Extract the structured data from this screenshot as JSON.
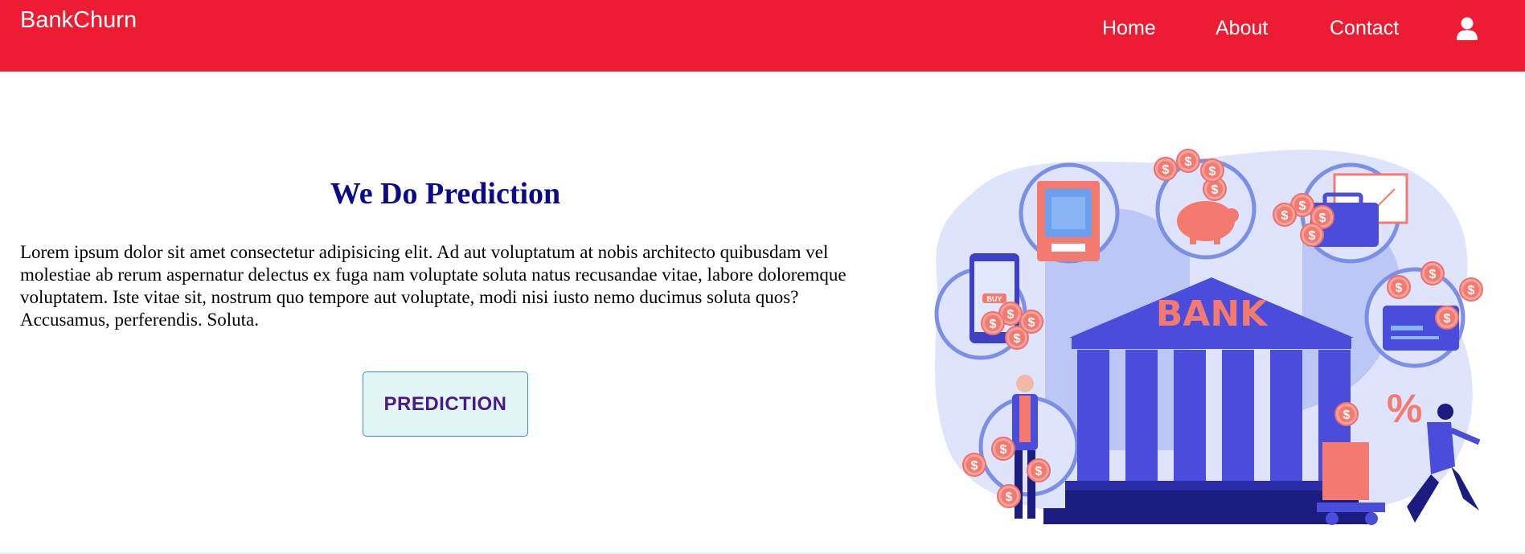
{
  "navbar": {
    "brand": "BankChurn",
    "links": [
      {
        "label": "Home"
      },
      {
        "label": "About"
      },
      {
        "label": "Contact"
      }
    ],
    "bg_color": "#ed1c33",
    "user_icon": "user-icon"
  },
  "hero": {
    "heading": "We Do Prediction",
    "paragraph": "Lorem ipsum dolor sit amet consectetur adipisicing elit. Ad aut voluptatum at nobis architecto quibusdam vel molestiae ab rerum aspernatur delectus ex fuga nam voluptate soluta natus recusandae vitae, labore doloremque voluptatem. Iste vitae sit, nostrum quo tempore aut voluptate, modi nisi iusto nemo ducimus soluta quos? Accusamus, perferendis. Soluta.",
    "button_label": "PREDICTION",
    "heading_color": "#0a0a8a"
  },
  "illustration": {
    "bank_label": "BANK",
    "percent_label": "%",
    "buy_label": "BUY",
    "coin_symbol": "$"
  }
}
